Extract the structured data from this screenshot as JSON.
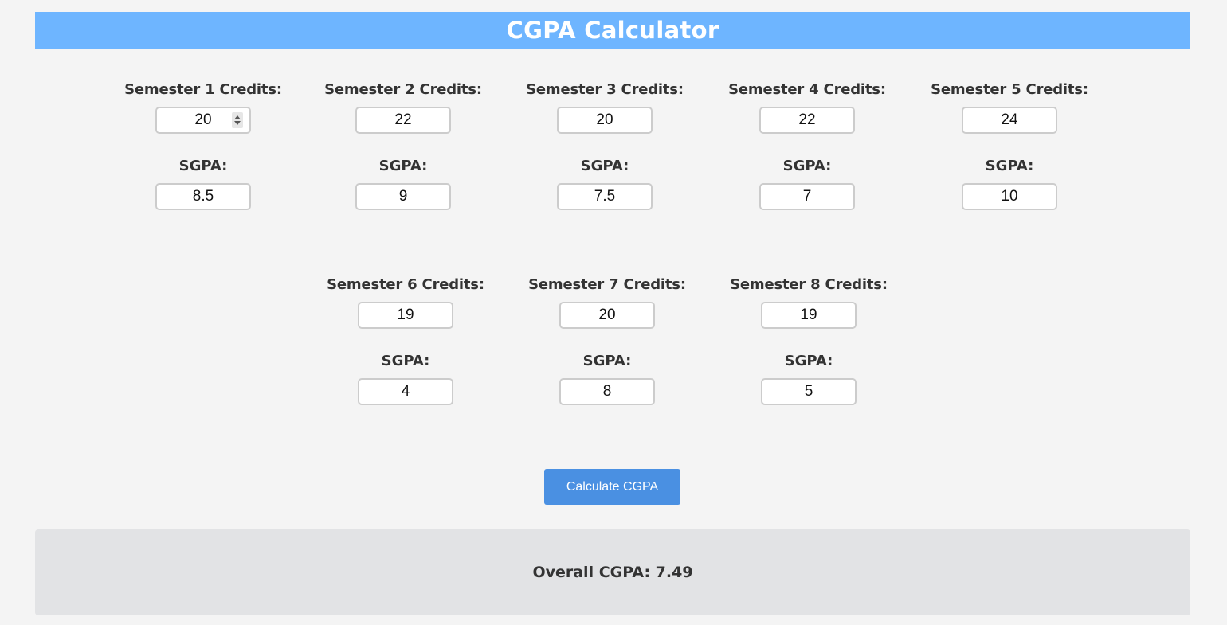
{
  "header": {
    "title": "CGPA Calculator"
  },
  "sgpa_label": "SGPA:",
  "semesters": [
    {
      "label": "Semester 1 Credits:",
      "credits": "20",
      "sgpa": "8.5"
    },
    {
      "label": "Semester 2 Credits:",
      "credits": "22",
      "sgpa": "9"
    },
    {
      "label": "Semester 3 Credits:",
      "credits": "20",
      "sgpa": "7.5"
    },
    {
      "label": "Semester 4 Credits:",
      "credits": "22",
      "sgpa": "7"
    },
    {
      "label": "Semester 5 Credits:",
      "credits": "24",
      "sgpa": "10"
    },
    {
      "label": "Semester 6 Credits:",
      "credits": "19",
      "sgpa": "4"
    },
    {
      "label": "Semester 7 Credits:",
      "credits": "20",
      "sgpa": "8"
    },
    {
      "label": "Semester 8 Credits:",
      "credits": "19",
      "sgpa": "5"
    }
  ],
  "button": {
    "label": "Calculate CGPA"
  },
  "result": {
    "text": "Overall CGPA: 7.49"
  },
  "colors": {
    "header_bg": "#6eb5ff",
    "button_bg": "#4a90e2",
    "result_bg": "#e2e3e5",
    "page_bg": "#f4f4f4"
  }
}
